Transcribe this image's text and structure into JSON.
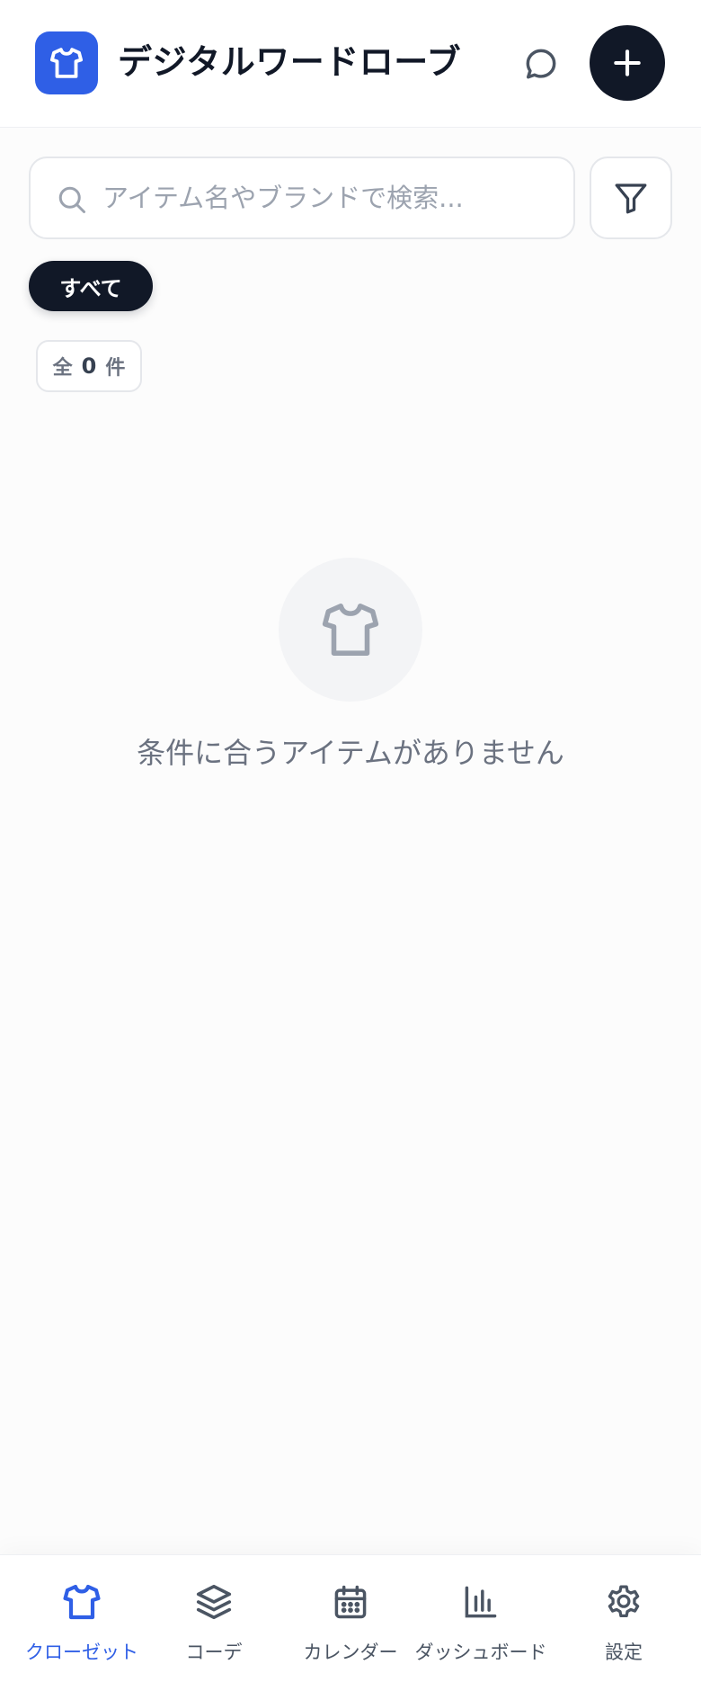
{
  "header": {
    "title": "デジタルワードローブ",
    "logo_icon": "shirt-icon",
    "chat_icon": "chat-bubble-icon",
    "add_icon": "plus-icon"
  },
  "search": {
    "placeholder": "アイテム名やブランドで検索...",
    "value": ""
  },
  "categories": [
    {
      "label": "すべて",
      "selected": true
    }
  ],
  "count": {
    "prefix": "全",
    "value": "0",
    "suffix": "件"
  },
  "empty_state": {
    "icon": "shirt-icon",
    "message": "条件に合うアイテムがありません"
  },
  "nav": {
    "items": [
      {
        "label": "クローゼット",
        "icon": "shirt-icon",
        "active": true
      },
      {
        "label": "コーデ",
        "icon": "layers-icon",
        "active": false
      },
      {
        "label": "カレンダー",
        "icon": "calendar-icon",
        "active": false
      },
      {
        "label": "ダッシュボード",
        "icon": "bar-chart-icon",
        "active": false
      },
      {
        "label": "設定",
        "icon": "gear-icon",
        "active": false
      }
    ]
  },
  "colors": {
    "accent": "#2f5fe6",
    "dark": "#111827",
    "muted_text": "#6b7280",
    "border": "#e5e7eb",
    "background": "#fcfcfc"
  }
}
